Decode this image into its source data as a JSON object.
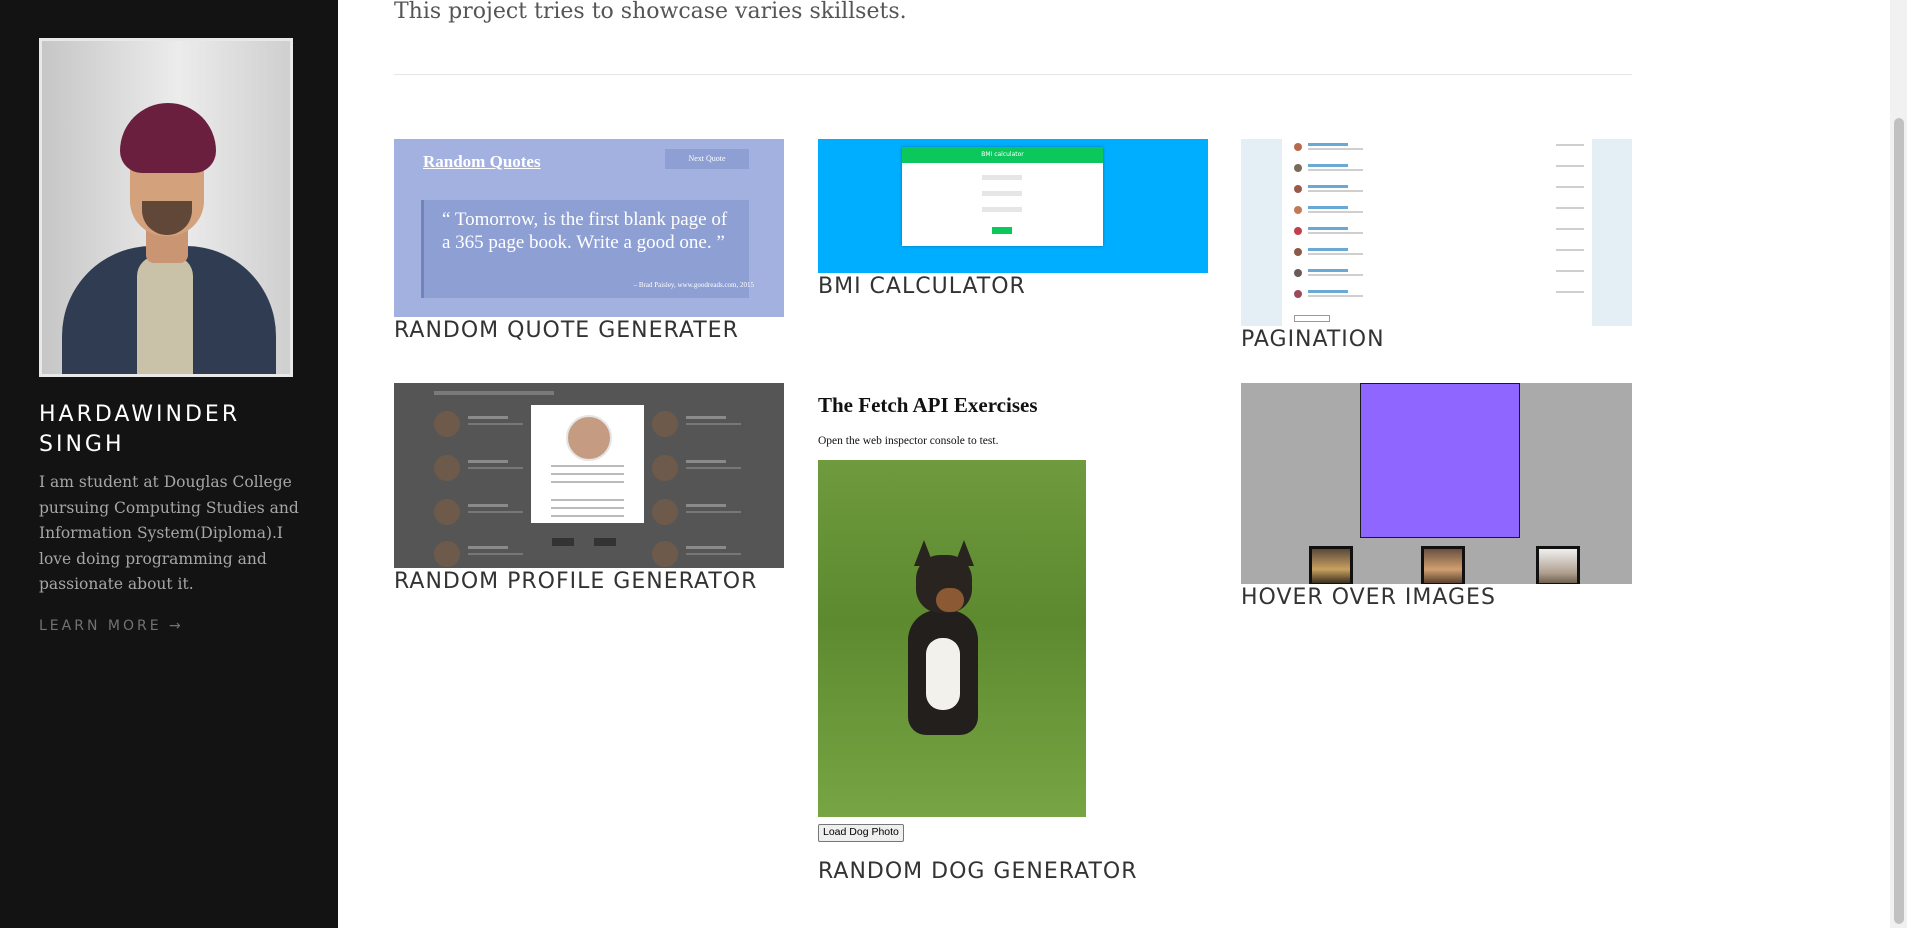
{
  "sidebar": {
    "name": "HARDAWINDER SINGH",
    "bio": "I am student at Douglas College pursuing Computing Studies and Information System(Diploma).I love doing programming and passionate about it.",
    "learn_more": "LEARN MORE →"
  },
  "main": {
    "intro": "This project tries to showcase varies skillsets.",
    "projects": [
      {
        "caption": "RANDOM QUOTE GENERATER"
      },
      {
        "caption": "BMI CALCULATOR"
      },
      {
        "caption": "PAGINATION"
      },
      {
        "caption": "RANDOM PROFILE GENERATOR"
      },
      {
        "caption": "RANDOM DOG GENERATOR"
      },
      {
        "caption": "HOVER OVER IMAGES"
      }
    ]
  },
  "thumbs": {
    "quote": {
      "title": "Random Quotes",
      "button": "Next Quote",
      "quote": "“ Tomorrow, is the first blank page of a 365 page book. Write a good one. ”",
      "author": "– Brad Paisley, www.goodreads.com, 2015"
    },
    "bmi": {
      "heading": "BMI calculator"
    },
    "fetch": {
      "title": "The Fetch API Exercises",
      "subtitle": "Open the web inspector console to test.",
      "button": "Load Dog Photo"
    }
  },
  "colors": {
    "sidebar_bg": "#131313",
    "quote_bg": "#a3b1e0",
    "bmi_bg": "#00aeff",
    "bmi_accent": "#0cc85c",
    "pagination_bg": "#e3eff5",
    "profile_bg": "#555555",
    "hover_bg": "#aaaaaa",
    "hover_accent": "#8f66ff"
  }
}
